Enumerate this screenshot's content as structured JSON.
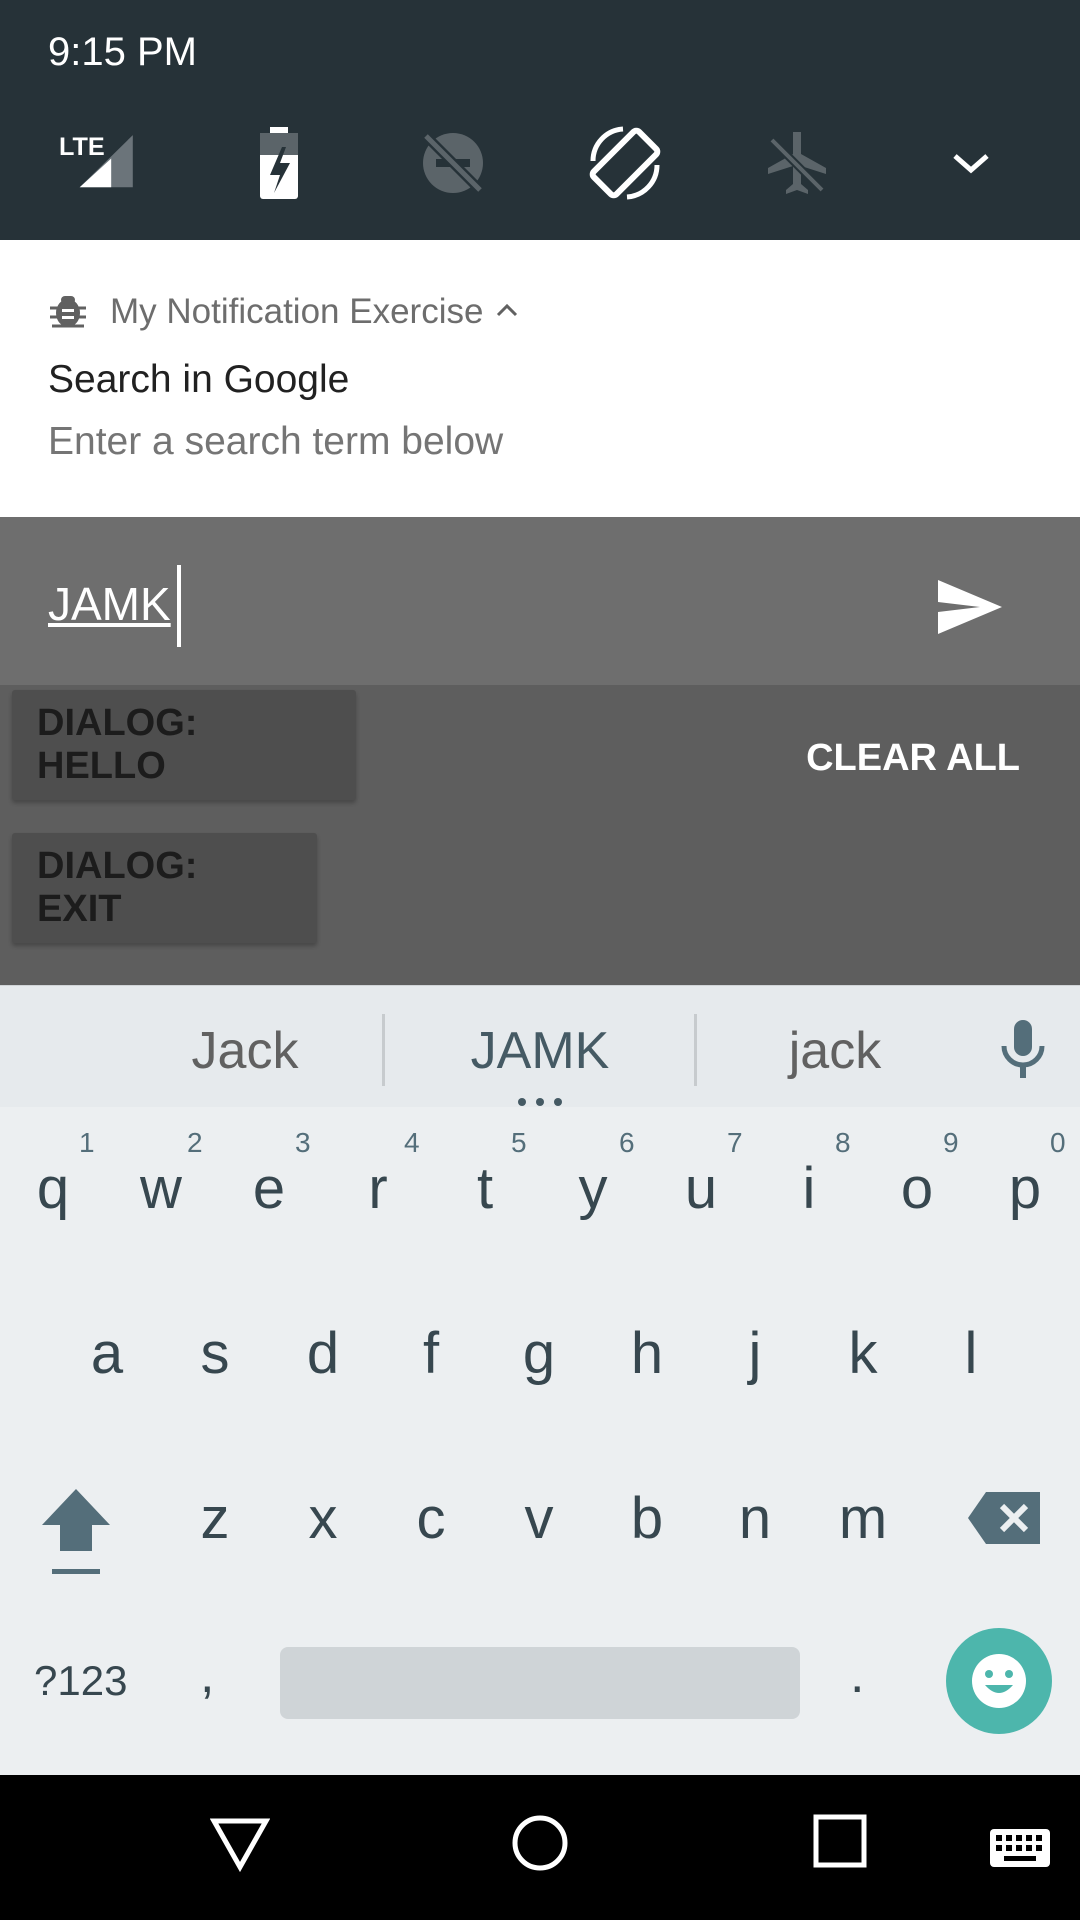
{
  "status_bar": {
    "time": "9:15 PM",
    "network_label": "LTE",
    "quick_tiles": [
      "signal-icon",
      "battery-charging-icon",
      "do-not-disturb-off-icon",
      "auto-rotate-icon",
      "airplane-mode-icon",
      "expand-chevron-icon"
    ]
  },
  "notification": {
    "app_name": "My Notification Exercise",
    "title": "Search in Google",
    "text": "Enter a search term below"
  },
  "reply": {
    "input_value": "JAMK"
  },
  "actions": {
    "hello_label": "DIALOG: HELLO",
    "exit_label": "DIALOG: EXIT",
    "clear_all_label": "CLEAR ALL"
  },
  "keyboard": {
    "suggestions": [
      "Jack",
      "JAMK",
      "jack"
    ],
    "row1": [
      "q",
      "w",
      "e",
      "r",
      "t",
      "y",
      "u",
      "i",
      "o",
      "p"
    ],
    "row1_hints": [
      "1",
      "2",
      "3",
      "4",
      "5",
      "6",
      "7",
      "8",
      "9",
      "0"
    ],
    "row2": [
      "a",
      "s",
      "d",
      "f",
      "g",
      "h",
      "j",
      "k",
      "l"
    ],
    "row3": [
      "z",
      "x",
      "c",
      "v",
      "b",
      "n",
      "m"
    ],
    "symbols_label": "?123",
    "comma_label": ",",
    "period_label": "."
  },
  "colors": {
    "status_bg": "#263238",
    "accent": "#4db6ac"
  }
}
